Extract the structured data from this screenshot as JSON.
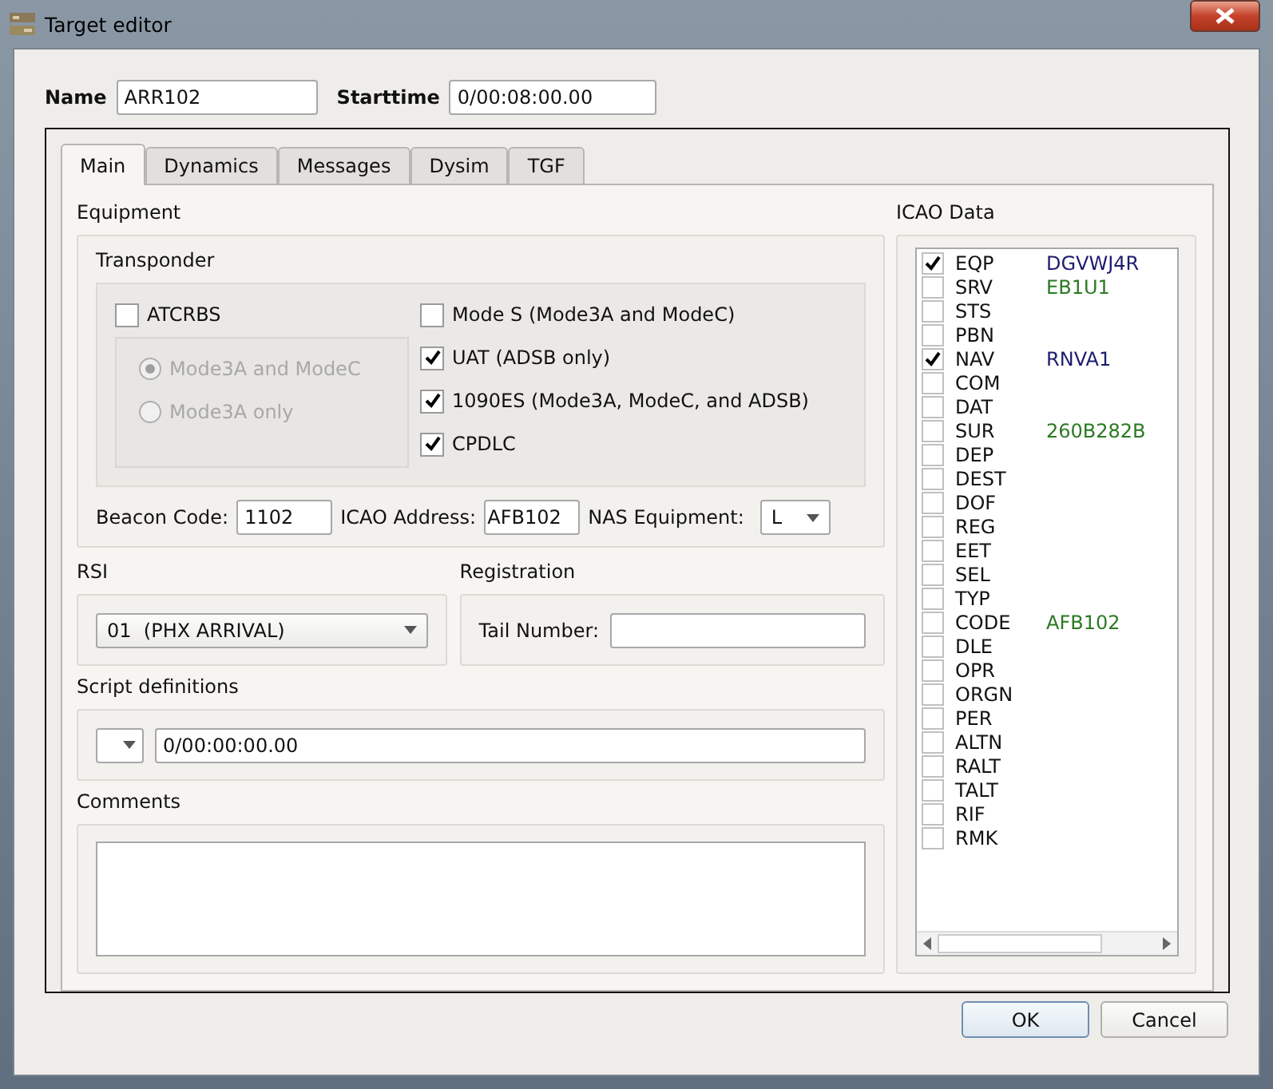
{
  "window": {
    "title": "Target editor"
  },
  "name": {
    "label": "Name",
    "value": "ARR102"
  },
  "starttime": {
    "label": "Starttime",
    "value": "0/00:08:00.00"
  },
  "tabs": [
    {
      "label": "Main",
      "selected": true
    },
    {
      "label": "Dynamics",
      "selected": false
    },
    {
      "label": "Messages",
      "selected": false
    },
    {
      "label": "Dysim",
      "selected": false
    },
    {
      "label": "TGF",
      "selected": false
    }
  ],
  "equipment": {
    "title": "Equipment",
    "transponder": {
      "title": "Transponder",
      "atcrbs": {
        "label": "ATCRBS",
        "checked": false
      },
      "radios": [
        {
          "label": "Mode3A and ModeC",
          "selected": true,
          "disabled": true
        },
        {
          "label": "Mode3A only",
          "selected": false,
          "disabled": true
        }
      ],
      "options": [
        {
          "label": "Mode S (Mode3A and ModeC)",
          "checked": false
        },
        {
          "label": "UAT (ADSB only)",
          "checked": true
        },
        {
          "label": "1090ES (Mode3A, ModeC, and ADSB)",
          "checked": true
        },
        {
          "label": "CPDLC",
          "checked": true
        }
      ]
    },
    "beacon_code": {
      "label": "Beacon Code:",
      "value": "1102"
    },
    "icao_address": {
      "label": "ICAO Address:",
      "value": "AFB102"
    },
    "nas_equipment": {
      "label": "NAS Equipment:",
      "value": "L"
    }
  },
  "rsi": {
    "title": "RSI",
    "value": "01  (PHX ARRIVAL)"
  },
  "registration": {
    "title": "Registration",
    "tail_number_label": "Tail Number:"
  },
  "script_definitions": {
    "title": "Script definitions",
    "time": "0/00:00:00.00"
  },
  "comments": {
    "title": "Comments"
  },
  "icao_data": {
    "title": "ICAO Data",
    "items": [
      {
        "code": "EQP",
        "value": "DGVWJ4R",
        "checked": true
      },
      {
        "code": "SRV",
        "value": "EB1U1",
        "checked": false
      },
      {
        "code": "STS",
        "checked": false
      },
      {
        "code": "PBN",
        "checked": false
      },
      {
        "code": "NAV",
        "value": "RNVA1",
        "checked": true
      },
      {
        "code": "COM",
        "checked": false
      },
      {
        "code": "DAT",
        "checked": false
      },
      {
        "code": "SUR",
        "value": "260B282B",
        "checked": false
      },
      {
        "code": "DEP",
        "checked": false
      },
      {
        "code": "DEST",
        "checked": false
      },
      {
        "code": "DOF",
        "checked": false
      },
      {
        "code": "REG",
        "checked": false
      },
      {
        "code": "EET",
        "checked": false
      },
      {
        "code": "SEL",
        "checked": false
      },
      {
        "code": "TYP",
        "checked": false
      },
      {
        "code": "CODE",
        "value": "AFB102",
        "checked": false
      },
      {
        "code": "DLE",
        "checked": false
      },
      {
        "code": "OPR",
        "checked": false
      },
      {
        "code": "ORGN",
        "checked": false
      },
      {
        "code": "PER",
        "checked": false
      },
      {
        "code": "ALTN",
        "checked": false
      },
      {
        "code": "RALT",
        "checked": false
      },
      {
        "code": "TALT",
        "checked": false
      },
      {
        "code": "RIF",
        "checked": false
      },
      {
        "code": "RMK",
        "checked": false
      }
    ]
  },
  "buttons": [
    {
      "label": "OK",
      "kind": "default"
    },
    {
      "label": "Cancel",
      "kind": "normal"
    }
  ]
}
